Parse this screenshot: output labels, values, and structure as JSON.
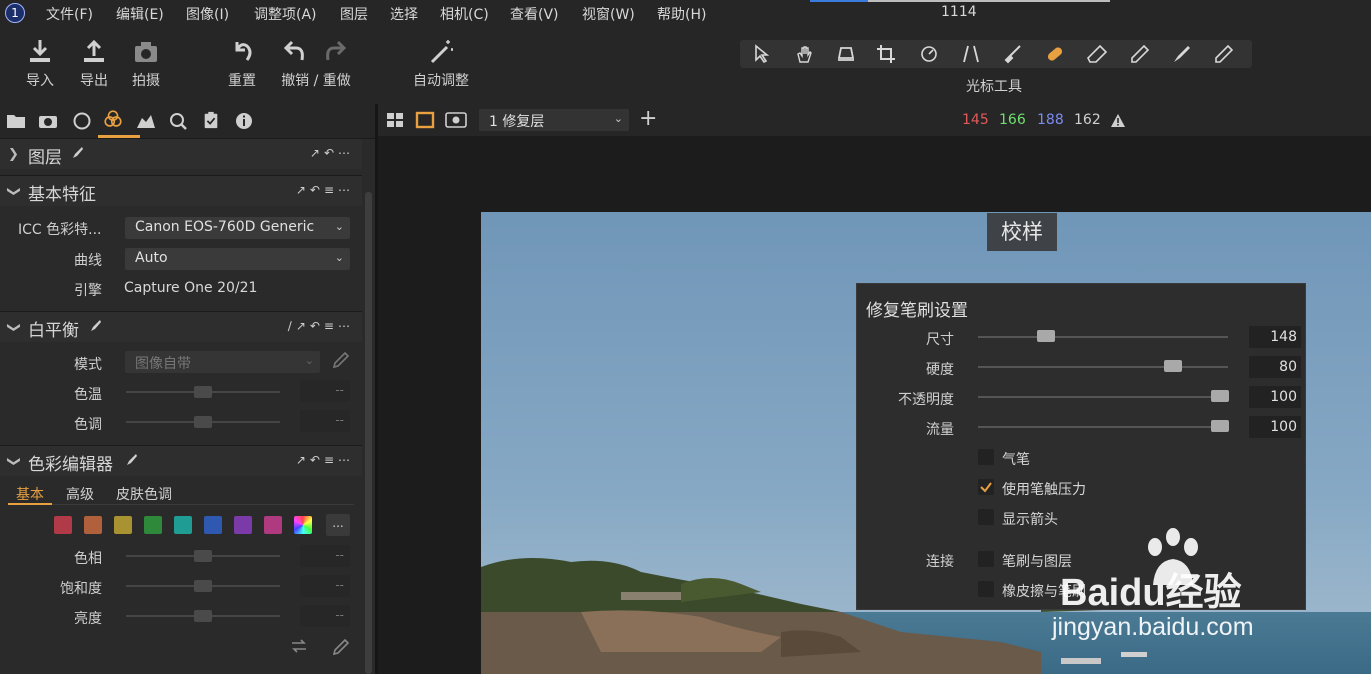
{
  "menu": {
    "logo": "1",
    "items": [
      "文件(F)",
      "编辑(E)",
      "图像(I)",
      "调整项(A)",
      "图层",
      "选择",
      "相机(C)",
      "查看(V)",
      "视窗(W)",
      "帮助(H)"
    ],
    "frame_number": "1114"
  },
  "toolbar": {
    "import": "导入",
    "export": "导出",
    "capture": "拍摄",
    "reset": "重置",
    "undo_redo": "撤销 / 重做",
    "auto_adjust": "自动调整",
    "cursor_tools_label": "光标工具"
  },
  "layers": {
    "title": "图层"
  },
  "basic": {
    "title": "基本特征",
    "icc_label": "ICC 色彩特...",
    "icc_value": "Canon EOS-760D Generic",
    "curve_label": "曲线",
    "curve_value": "Auto",
    "engine_label": "引擎",
    "engine_value": "Capture One 20/21"
  },
  "wb": {
    "title": "白平衡",
    "mode_label": "模式",
    "mode_value": "图像自带",
    "temp_label": "色温",
    "temp_value": "--",
    "tint_label": "色调",
    "tint_value": "--"
  },
  "color_editor": {
    "title": "色彩编辑器",
    "tabs": [
      "基本",
      "高级",
      "皮肤色调"
    ],
    "more": "...",
    "swatch_colors": [
      "#b03a48",
      "#b0603a",
      "#a89232",
      "#2e8a3a",
      "#1f9c94",
      "#2f58b0",
      "#7a3aa8",
      "#b03a80"
    ],
    "hue_label": "色相",
    "hue_value": "--",
    "sat_label": "饱和度",
    "sat_value": "--",
    "light_label": "亮度",
    "light_value": "--"
  },
  "viewer": {
    "layer_select": "1 修复层",
    "readout": {
      "r": "145",
      "g": "166",
      "b": "188",
      "l": "162"
    },
    "readout_colors": {
      "r": "#e05a5a",
      "g": "#6fe06f",
      "b": "#7a8cf0",
      "l": "#d0d0d0"
    },
    "proof_label": "校样"
  },
  "brush_settings": {
    "title": "修复笔刷设置",
    "size_label": "尺寸",
    "size_value": "148",
    "hardness_label": "硬度",
    "hardness_value": "80",
    "opacity_label": "不透明度",
    "opacity_value": "100",
    "flow_label": "流量",
    "flow_value": "100",
    "airbrush_label": "气笔",
    "pressure_label": "使用笔触压力",
    "arrows_label": "显示箭头",
    "link_label": "连接",
    "brush_layer_label": "笔刷与图层",
    "eraser_brush_label": "橡皮擦与笔刷"
  },
  "watermark": {
    "logo_text": "Baidu经验",
    "url": "jingyan.baidu.com"
  },
  "accent_color": "#e8a040"
}
